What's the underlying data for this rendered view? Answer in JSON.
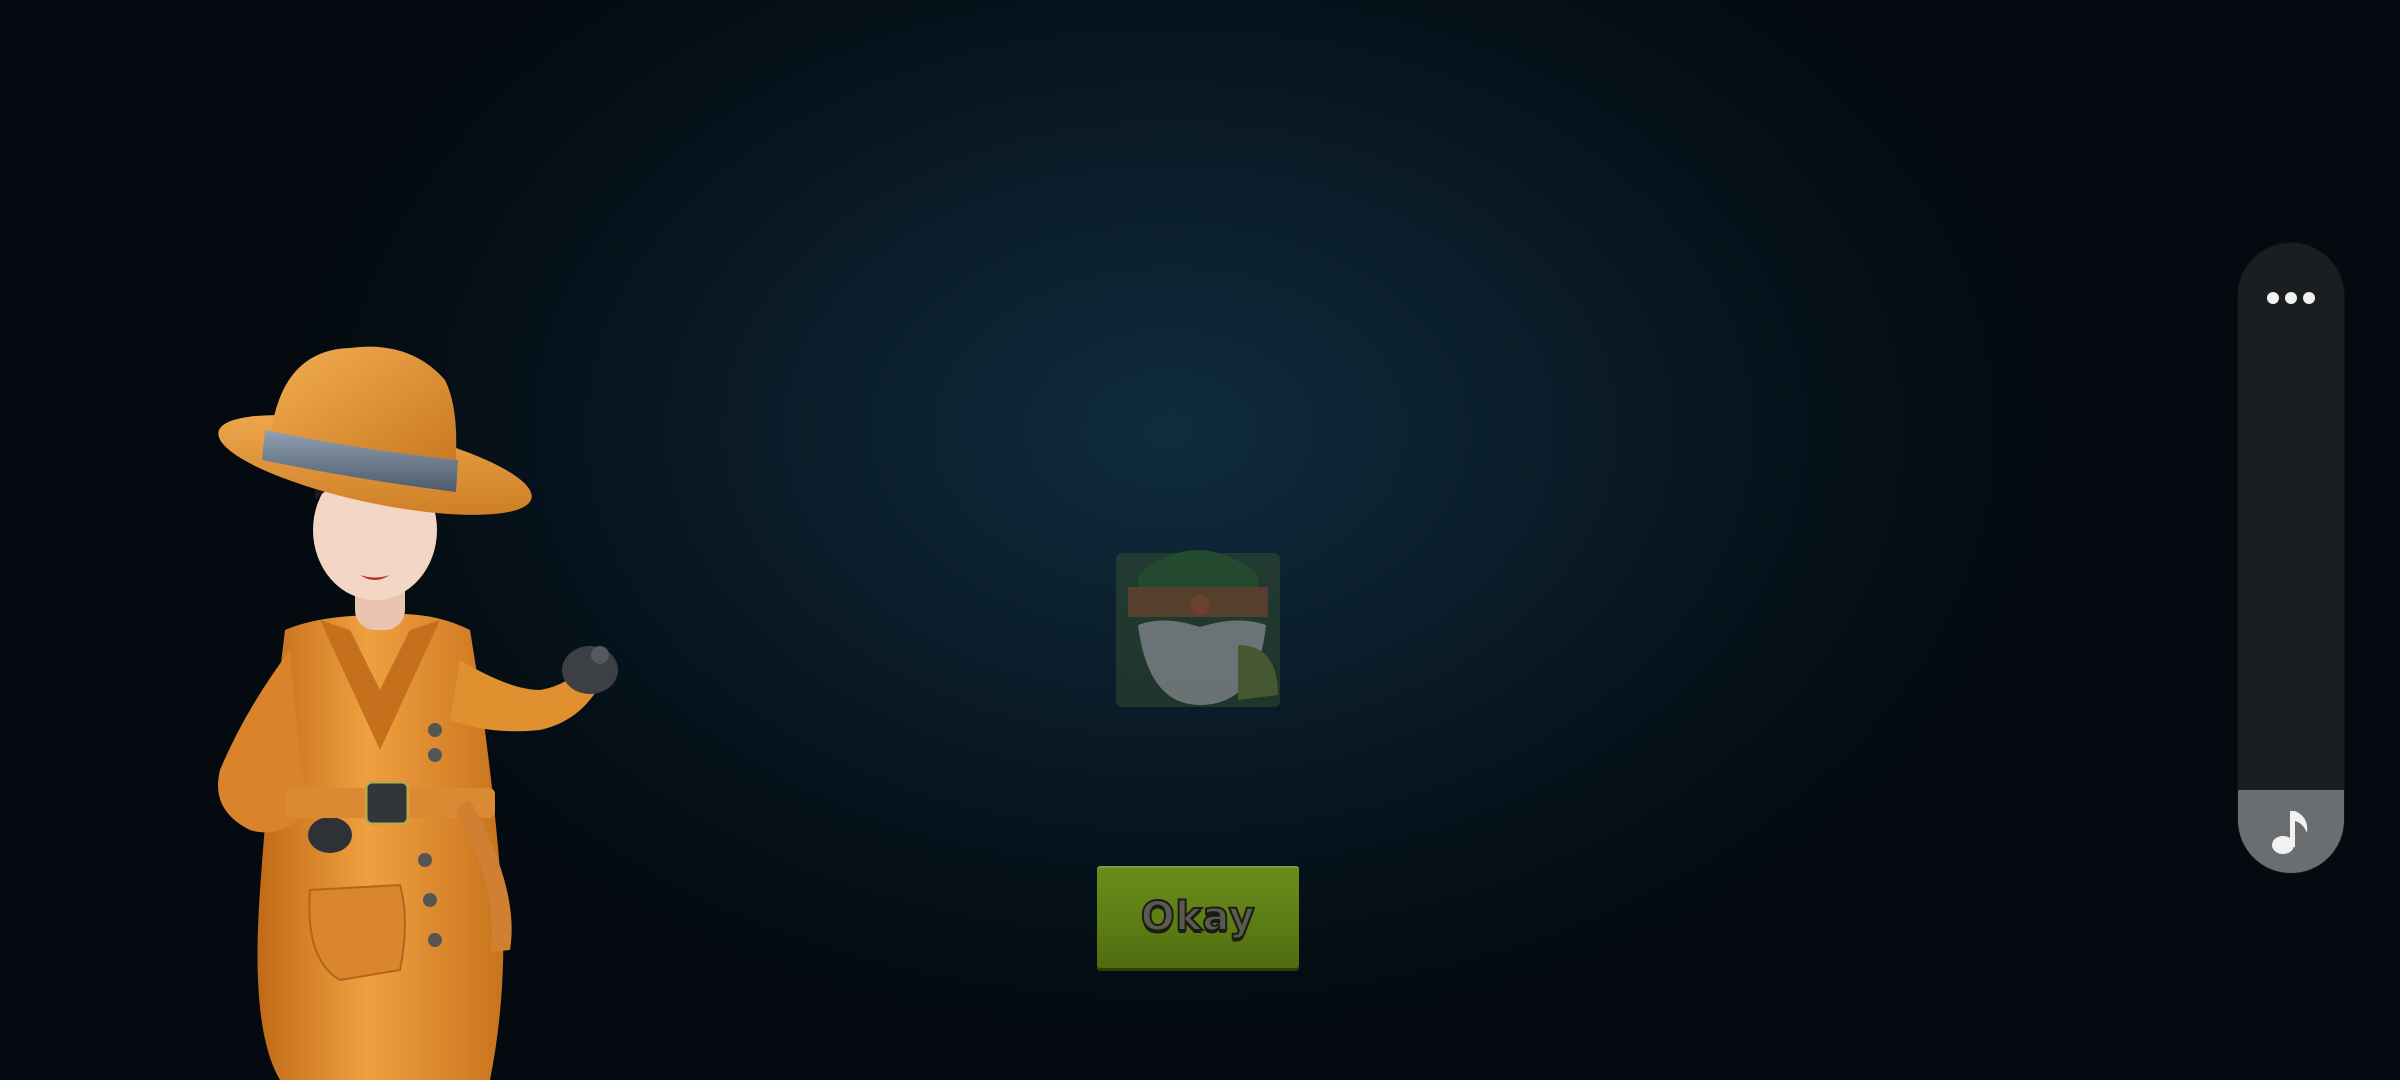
{
  "dialog": {
    "okay_label": "Okay"
  },
  "side_panel": {
    "more_icon": "more-horizontal-icon",
    "music_icon": "music-note-icon"
  },
  "colors": {
    "button_green": "#6b8c1c",
    "panel_dark": "#1b1e21",
    "panel_active": "#6b6e71",
    "detective_coat": "#e8962e"
  }
}
